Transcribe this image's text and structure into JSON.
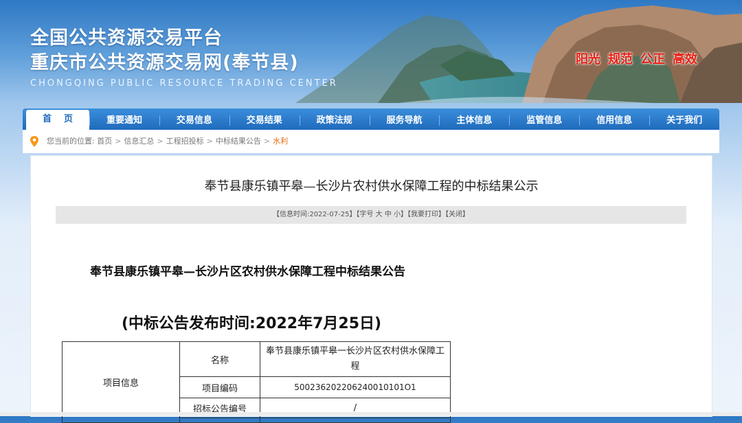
{
  "header": {
    "title_line1": "全国公共资源交易平台",
    "title_line2": "重庆市公共资源交易网(奉节县)",
    "title_en": "CHONGQING PUBLIC RESOURCE TRADING CENTER",
    "slogans": [
      "阳光",
      "规范",
      "公正",
      "高效"
    ],
    "slogan_color": "#e81e12"
  },
  "nav": {
    "items": [
      "首页",
      "重要通知",
      "交易信息",
      "交易结果",
      "政策法规",
      "服务导航",
      "主体信息",
      "监管信息",
      "信用信息",
      "关于我们"
    ],
    "active_index": 0,
    "color": "#1f6bbd"
  },
  "breadcrumb": {
    "prefix": "您当前的位置:",
    "items": [
      "首页",
      "信息汇总",
      "工程招投标",
      "中标结果公告",
      "水利"
    ],
    "separator": ">"
  },
  "article": {
    "title": "奉节县康乐镇平皋—长沙片农村供水保障工程的中标结果公示",
    "info_time": "【信息时间:2022-07-25】",
    "font_prefix": "【字号",
    "font_large": "大",
    "font_medium": "中",
    "font_small": "小】",
    "print_label": "【我要打印】",
    "close_label": "【关闭】",
    "notice_title": "奉节县康乐镇平皋—长沙片区农村供水保障工程中标结果公告",
    "notice_date": "(中标公告发布时间:2022年7月25日)",
    "table": {
      "group_label": "项目信息",
      "rows": [
        {
          "label": "名称",
          "value": "奉节县康乐镇平皋一长沙片区农村供水保障工程"
        },
        {
          "label": "项目编码",
          "value": "500236202206240010101O1"
        },
        {
          "label": "招标公告编号",
          "value": "/"
        }
      ]
    }
  }
}
